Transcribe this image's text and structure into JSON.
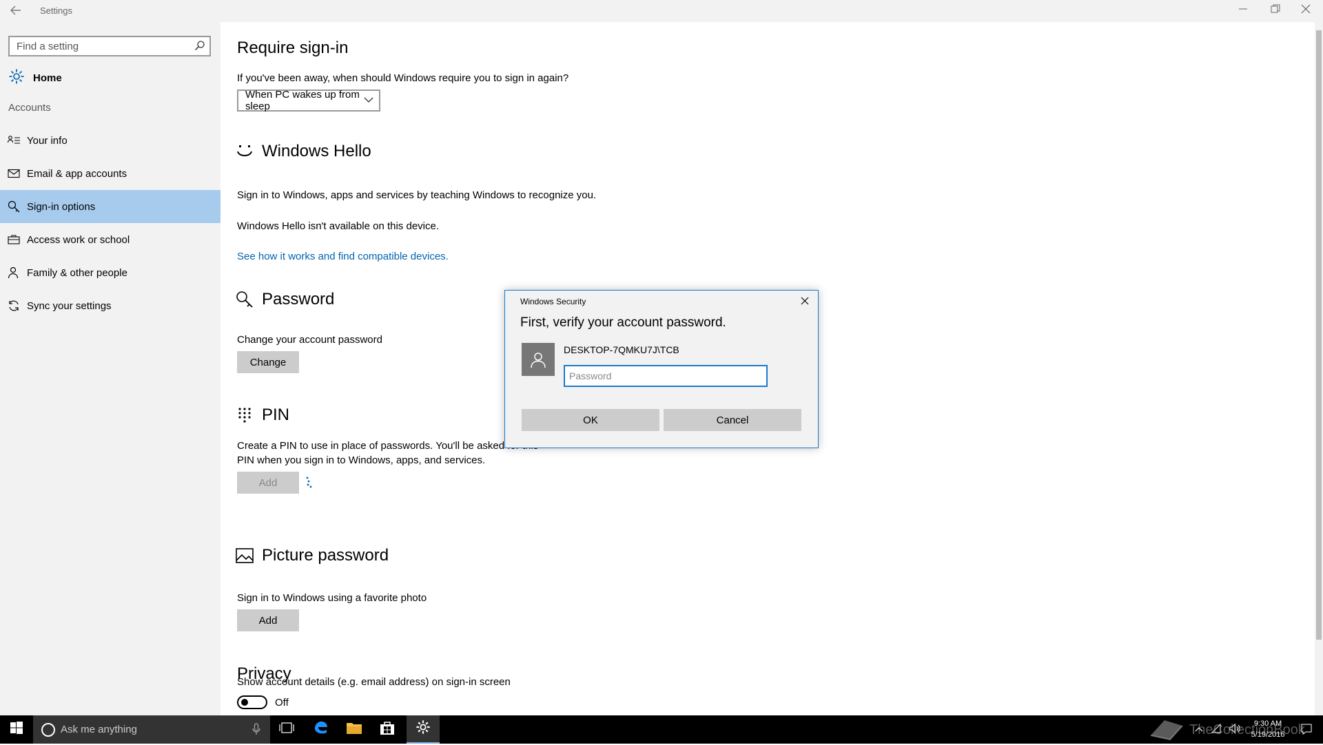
{
  "window": {
    "title": "Settings",
    "controls": {
      "minimize": "—",
      "restore": "❐",
      "close": "✕"
    }
  },
  "sidebar": {
    "search_placeholder": "Find a setting",
    "home_label": "Home",
    "section_label": "Accounts",
    "items": [
      {
        "label": "Your info",
        "icon": "person-list-icon"
      },
      {
        "label": "Email & app accounts",
        "icon": "mail-icon"
      },
      {
        "label": "Sign-in options",
        "icon": "key-icon",
        "selected": true
      },
      {
        "label": "Access work or school",
        "icon": "briefcase-icon"
      },
      {
        "label": "Family & other people",
        "icon": "people-icon"
      },
      {
        "label": "Sync your settings",
        "icon": "sync-icon"
      }
    ]
  },
  "require_signin": {
    "title": "Require sign-in",
    "question": "If you've been away, when should Windows require you to sign in again?",
    "selected": "When PC wakes up from sleep"
  },
  "windows_hello": {
    "title": "Windows Hello",
    "description": "Sign in to Windows, apps and services by teaching Windows to recognize you.",
    "unavailable": "Windows Hello isn't available on this device.",
    "link": "See how it works and find compatible devices."
  },
  "password": {
    "title": "Password",
    "description": "Change your account password",
    "button": "Change"
  },
  "pin": {
    "title": "PIN",
    "description_line1": "Create a PIN to use in place of passwords. You'll be asked for this",
    "description_line2": "PIN when you sign in to Windows, apps, and services.",
    "button": "Add"
  },
  "picture_password": {
    "title": "Picture password",
    "description": "Sign in to Windows using a favorite photo",
    "button": "Add"
  },
  "privacy": {
    "title": "Privacy",
    "description": "Show account details (e.g. email address) on sign-in screen",
    "toggle_state": "Off"
  },
  "dialog": {
    "title": "Windows Security",
    "heading": "First, verify your account password.",
    "username": "DESKTOP-7QMKU7J\\TCB",
    "password_placeholder": "Password",
    "ok": "OK",
    "cancel": "Cancel"
  },
  "taskbar": {
    "search_text": "Ask me anything",
    "time": "9:30 AM",
    "date": "5/19/2016"
  },
  "watermark": "TheCollectionBook",
  "colors": {
    "accent": "#0063b1",
    "selected_nav": "#a7cbed",
    "sidebar_bg": "#f2f2f2",
    "taskbar_bg": "#000000",
    "dialog_border": "#1979ca"
  }
}
